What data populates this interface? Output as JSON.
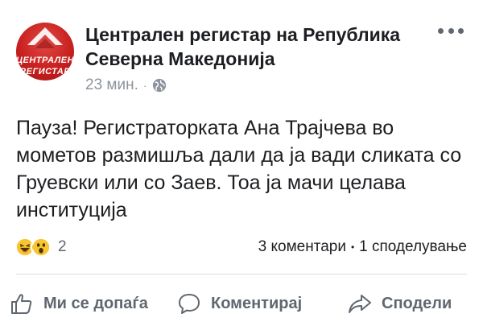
{
  "post": {
    "page_name": "Централен регистар на Република Северна Македонија",
    "avatar_text_line1": "ЦЕНТРАЛЕН",
    "avatar_text_line2": "РЕГИСТАР",
    "time": "23 мин.",
    "privacy_icon": "globe-icon",
    "body": "Пауза! Регистраторката Ана Трајчева во мометов размишља дали да ја вади сликата со Груевски или со Заев. Тоа ја мачи целава институција",
    "reactions": {
      "icons": [
        "haha-reaction-icon",
        "wow-reaction-icon"
      ],
      "count": "2"
    },
    "comments": "3 коментари",
    "separator": "•",
    "shares": "1 споделување"
  },
  "actions": {
    "like_label": "Ми се допаѓа",
    "comment_label": "Коментирај",
    "share_label": "Сподели"
  },
  "colors": {
    "brand_red": "#c8201f",
    "text": "#1c1e21",
    "secondary": "#606770",
    "meta": "#8d949e"
  }
}
